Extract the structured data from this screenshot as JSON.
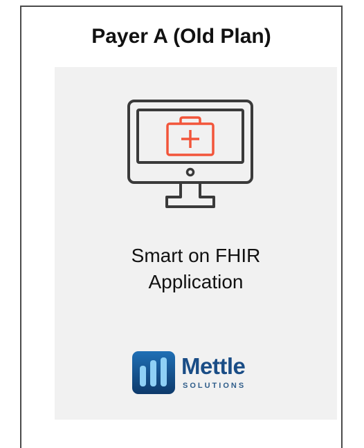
{
  "card": {
    "title": "Payer A (Old Plan)"
  },
  "panel": {
    "icon": "monitor-medical-kit-icon",
    "label_line1": "Smart on FHIR",
    "label_line2": "Application"
  },
  "logo": {
    "word": "Mettle",
    "sub": "SOLUTIONS"
  },
  "colors": {
    "border": "#4a4a4a",
    "panel_bg": "#f1f1f1",
    "monitor_stroke": "#3a3a3a",
    "medical_accent": "#f2553a",
    "logo_blue": "#1a4d86"
  }
}
